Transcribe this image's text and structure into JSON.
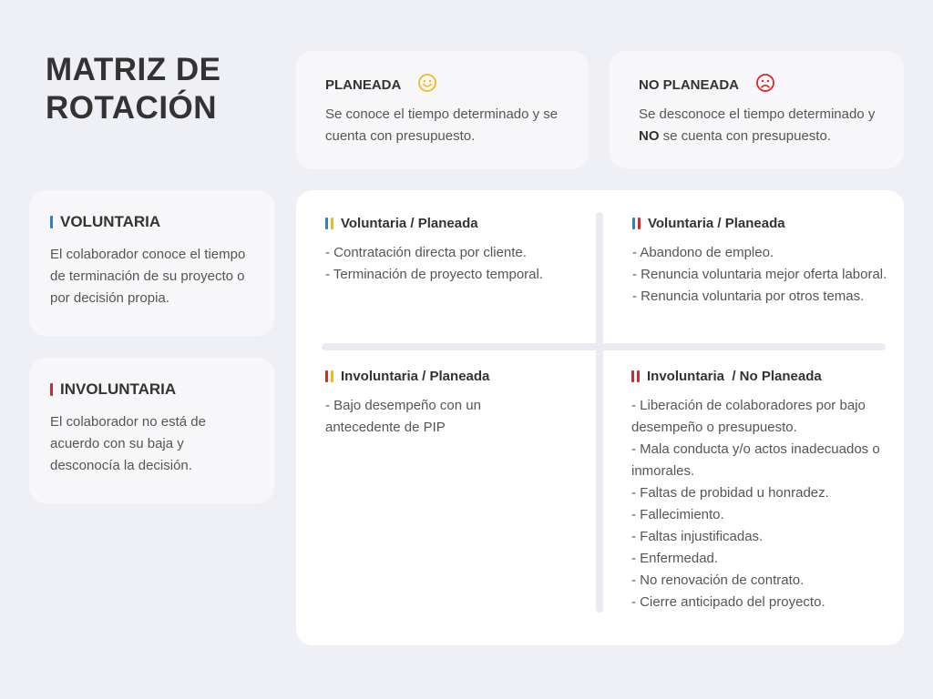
{
  "title": {
    "line1": "MATRIZ DE",
    "line2": "ROTACIÓN"
  },
  "colors": {
    "blue": "#2f7fc1",
    "red": "#d12b2b",
    "yellow": "#f2b81c"
  },
  "planeada": {
    "title": "PLANEADA",
    "icon": "smiley-face-icon",
    "text": "Se conoce el tiempo determinado y se cuenta con presupuesto."
  },
  "no_planeada": {
    "title": "NO PLANEADA",
    "icon": "frowning-face-icon",
    "text_before": "Se desconoce el tiempo determinado y ",
    "text_bold": "NO",
    "text_after": " se cuenta con presupuesto."
  },
  "voluntaria": {
    "title": "VOLUNTARIA",
    "text": "El colaborador conoce el tiempo de terminación de su proyecto o por decisión propia."
  },
  "involuntaria": {
    "title": "INVOLUNTARIA",
    "text": "El colaborador no está de acuerdo con su baja y desconocía la decisión."
  },
  "quadrants": {
    "q1": {
      "title": "Voluntaria / Planeada",
      "items": [
        "- Contratación directa por cliente.",
        "- Terminación de proyecto temporal."
      ]
    },
    "q2": {
      "title": "Voluntaria / Planeada",
      "items": [
        "- Abandono de empleo.",
        "- Renuncia voluntaria mejor oferta laboral.",
        "- Renuncia voluntaria por otros temas."
      ]
    },
    "q3": {
      "title": "Involuntaria / Planeada",
      "items": [
        "- Bajo desempeño con un antecedente de PIP"
      ]
    },
    "q4": {
      "title": "Involuntaria  / No Planeada",
      "items": [
        "- Liberación de colaboradores por bajo desempeño o presupuesto.",
        "- Mala conducta y/o actos inadecuados o inmorales.",
        "- Faltas de probidad u honradez.",
        "- Fallecimiento.",
        "- Faltas injustificadas.",
        "- Enfermedad.",
        "- No renovación de contrato.",
        "- Cierre anticipado del proyecto."
      ]
    }
  }
}
